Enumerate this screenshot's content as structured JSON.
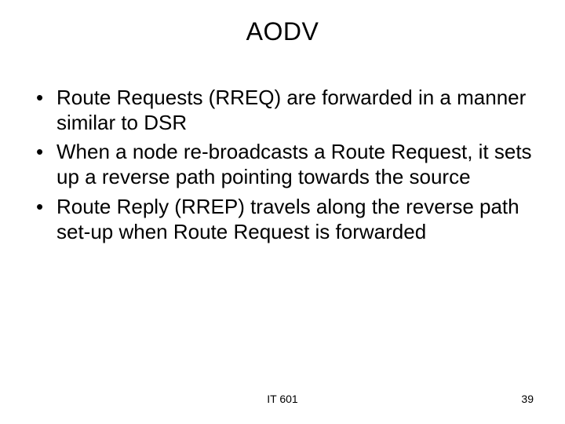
{
  "title": "AODV",
  "bullets": [
    "Route Requests (RREQ) are forwarded in a manner similar to DSR",
    "When a node re-broadcasts a Route Request, it sets up a reverse path pointing towards the source",
    "Route Reply  (RREP) travels along the reverse path set-up when Route Request is forwarded"
  ],
  "footer": {
    "course": "IT 601",
    "page": "39"
  }
}
